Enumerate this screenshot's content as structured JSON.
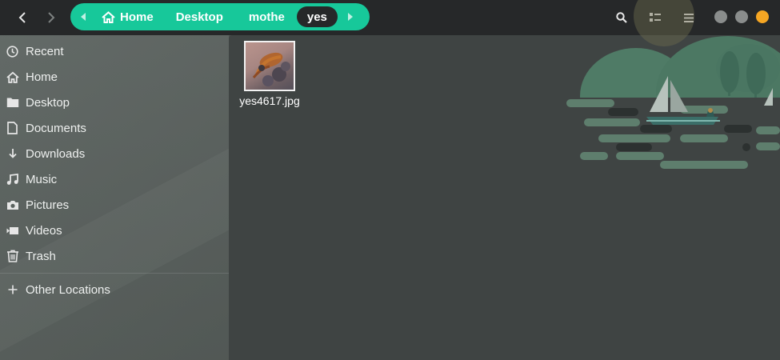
{
  "header": {
    "back_icon": "chevron-left-icon",
    "forward_icon": "chevron-right-icon",
    "pathbar": {
      "accent": "#17c89a",
      "crumbs": [
        {
          "label": "Home",
          "icon": "home-icon"
        },
        {
          "label": "Desktop"
        },
        {
          "label": "mothe"
        },
        {
          "label": "yes"
        }
      ]
    },
    "tools": [
      "search-icon",
      "view-options-icon",
      "menu-icon"
    ],
    "window_controls": {
      "minimize_color": "#8a8d8c",
      "maximize_color": "#8a8d8c",
      "close_color": "#f5a623"
    }
  },
  "sidebar": {
    "items": [
      {
        "label": "Recent",
        "icon": "clock-icon"
      },
      {
        "label": "Home",
        "icon": "home-icon"
      },
      {
        "label": "Desktop",
        "icon": "folder-icon"
      },
      {
        "label": "Documents",
        "icon": "document-icon"
      },
      {
        "label": "Downloads",
        "icon": "download-icon"
      },
      {
        "label": "Music",
        "icon": "music-icon"
      },
      {
        "label": "Pictures",
        "icon": "camera-icon"
      },
      {
        "label": "Videos",
        "icon": "video-icon"
      },
      {
        "label": "Trash",
        "icon": "trash-icon"
      }
    ],
    "other_locations": {
      "label": "Other Locations",
      "icon": "plus-icon"
    }
  },
  "main": {
    "files": [
      {
        "name": "yes4617.jpg",
        "icon": "image-thumbnail"
      }
    ]
  }
}
